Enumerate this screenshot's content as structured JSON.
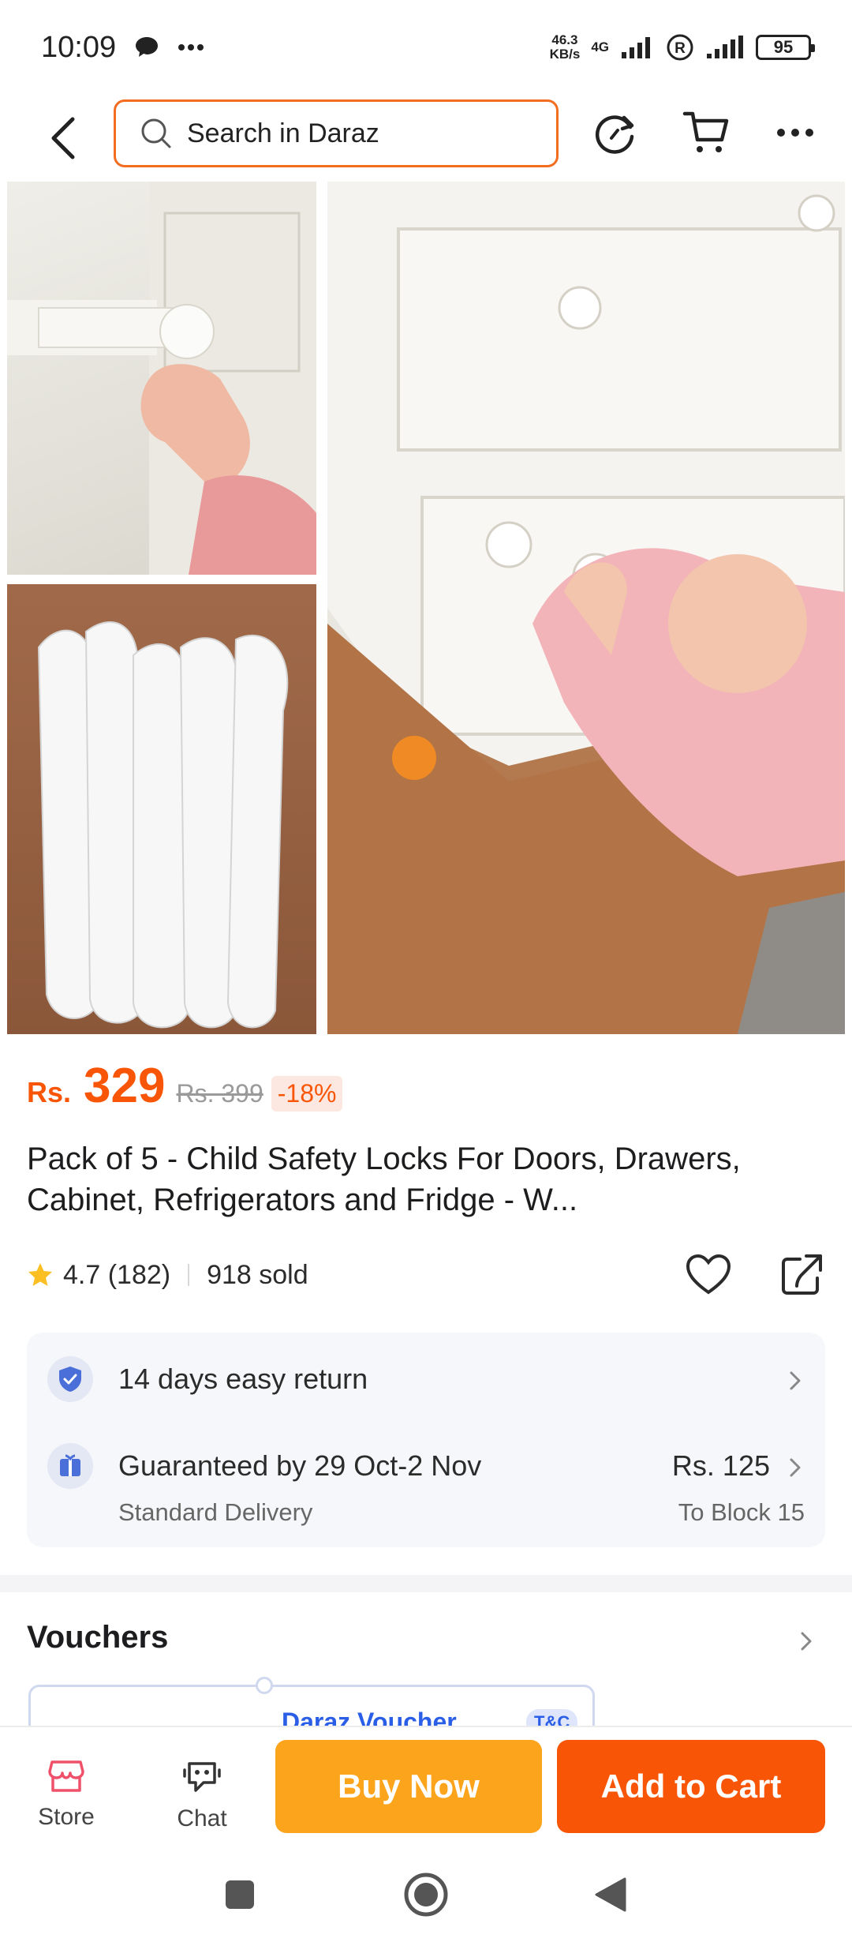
{
  "status_bar": {
    "time": "10:09",
    "speed_value": "46.3",
    "speed_unit": "KB/s",
    "network": "4G",
    "battery": "95"
  },
  "top_nav": {
    "search_placeholder": "Search in Daraz"
  },
  "product": {
    "currency": "Rs.",
    "price": "329",
    "original_price": "Rs. 399",
    "discount": "-18%",
    "title": "Pack of 5 - Child Safety Locks For Doors, Drawers, Cabinet, Refrigerators and Fridge - W...",
    "rating": "4.7 (182)",
    "sold": "918 sold"
  },
  "services": {
    "return_text": "14 days easy return",
    "delivery_text": "Guaranteed by 29 Oct-2 Nov",
    "delivery_type": "Standard Delivery",
    "delivery_fee": "Rs. 125",
    "delivery_location": "To Block 15"
  },
  "vouchers": {
    "heading": "Vouchers",
    "card_label": "Daraz Voucher",
    "tc": "T&C"
  },
  "action_bar": {
    "store_label": "Store",
    "chat_label": "Chat",
    "buy_now_label": "Buy Now",
    "add_to_cart_label": "Add to Cart"
  },
  "colors": {
    "brand_orange": "#f85606",
    "buy_now": "#fca41c",
    "voucher_blue": "#2a5ee7"
  }
}
